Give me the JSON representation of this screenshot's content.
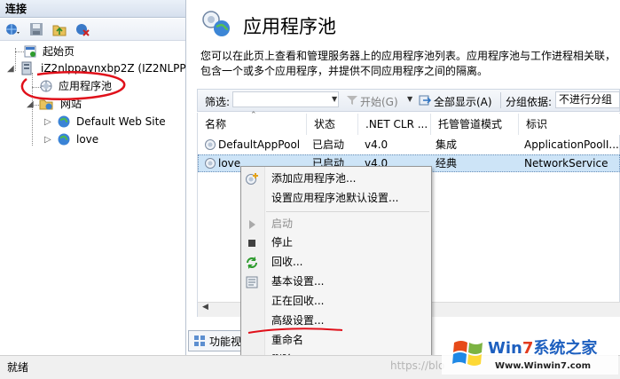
{
  "connections": {
    "header": "连接",
    "tree": {
      "start_page": "起始页",
      "server": "iZ2nlppavnxbp2Z (IZ2NLPP",
      "app_pools": "应用程序池",
      "sites": "网站",
      "site1": "Default Web Site",
      "site2": "love"
    }
  },
  "main": {
    "title": "应用程序池",
    "description": "您可以在此页上查看和管理服务器上的应用程序池列表。应用程序池与工作进程相关联，包含一个或多个应用程序，并提供不同应用程序之间的隔离。"
  },
  "filter_bar": {
    "filter_label": "筛选:",
    "filter_value": "",
    "start_label": "开始(G)",
    "show_all_label": "全部显示(A)",
    "group_by_label": "分组依据:",
    "group_by_value": "不进行分组"
  },
  "grid": {
    "columns": [
      "名称",
      "状态",
      ".NET CLR ...",
      "托管管道模式",
      "标识"
    ],
    "rows": [
      {
        "name": "DefaultAppPool",
        "status": "已启动",
        "clr": "v4.0",
        "pipeline": "集成",
        "identity": "ApplicationPoolI..."
      },
      {
        "name": "love",
        "status": "已启动",
        "clr": "v4.0",
        "pipeline": "经典",
        "identity": "NetworkService"
      }
    ]
  },
  "view_tab": "功能视",
  "context_menu": {
    "items": [
      {
        "label": "添加应用程序池...",
        "icon": "add-pool-icon",
        "enabled": true
      },
      {
        "label": "设置应用程序池默认设置...",
        "icon": "",
        "enabled": true
      },
      {
        "label": "启动",
        "icon": "play-icon",
        "enabled": false
      },
      {
        "label": "停止",
        "icon": "stop-icon",
        "enabled": true
      },
      {
        "label": "回收...",
        "icon": "recycle-icon",
        "enabled": true
      },
      {
        "label": "基本设置...",
        "icon": "settings-icon",
        "enabled": true
      },
      {
        "label": "正在回收...",
        "icon": "",
        "enabled": true
      },
      {
        "label": "高级设置...",
        "icon": "",
        "enabled": true
      },
      {
        "label": "重命名",
        "icon": "",
        "enabled": true
      },
      {
        "label": "删除",
        "icon": "delete-icon",
        "enabled": true
      }
    ]
  },
  "status_bar": {
    "text": "就绪",
    "watermark": "https://blo"
  },
  "logo": {
    "brand": "Win7系统之家",
    "url": "Www.Winwin7.com"
  },
  "colors": {
    "selection": "#cde4f7",
    "annotation": "#e0101a",
    "header_gradient": "#d6e0ee"
  }
}
